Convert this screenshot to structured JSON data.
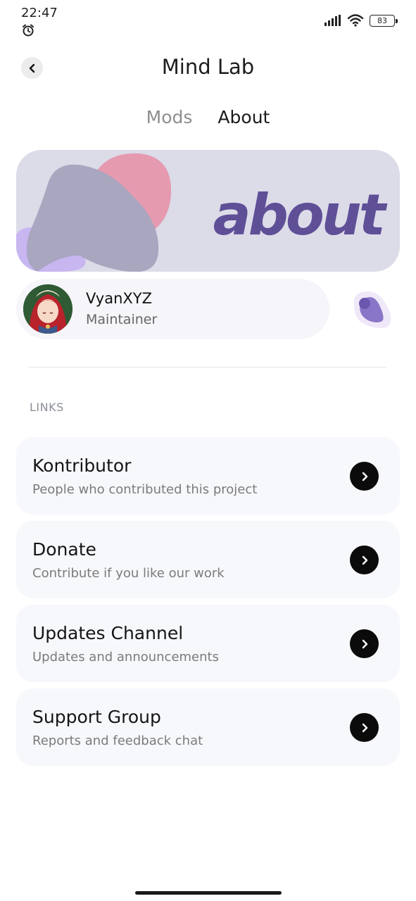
{
  "status_bar": {
    "time": "22:47",
    "battery": "83",
    "icons": [
      "alarm-icon",
      "signal-icon",
      "wifi-icon",
      "battery-icon"
    ]
  },
  "header": {
    "title": "Mind Lab",
    "back_icon": "chevron-left-icon"
  },
  "tabs": [
    {
      "label": "Mods",
      "active": false
    },
    {
      "label": "About",
      "active": true
    }
  ],
  "banner": {
    "text": "about",
    "colors": {
      "background": "#dcdbe8",
      "accent": "#5e4f97",
      "pink": "#e59ab0",
      "gray": "#a9a6c0",
      "lavender": "#c7b6f0"
    }
  },
  "profile": {
    "name": "VyanXYZ",
    "role": "Maintainer"
  },
  "links": {
    "header": "LINKS",
    "items": [
      {
        "title": "Kontributor",
        "subtitle": "People who contributed this project",
        "icon": "chevron-right-icon"
      },
      {
        "title": "Donate",
        "subtitle": "Contribute if you like our work",
        "icon": "chevron-right-icon"
      },
      {
        "title": "Updates Channel",
        "subtitle": "Updates and announcements",
        "icon": "chevron-right-icon"
      },
      {
        "title": "Support Group",
        "subtitle": "Reports and feedback chat",
        "icon": "chevron-right-icon"
      }
    ]
  }
}
